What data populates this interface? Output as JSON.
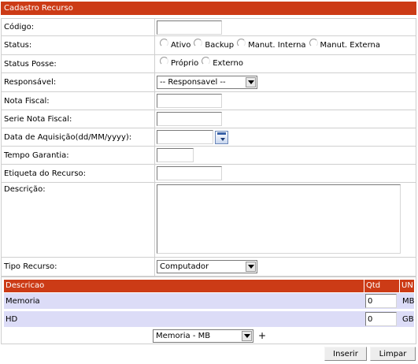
{
  "form": {
    "title": "Cadastro Recurso",
    "codigo": {
      "label": "Código:",
      "value": ""
    },
    "status": {
      "label": "Status:",
      "options": [
        "Ativo",
        "Backup",
        "Manut. Interna",
        "Manut. Externa"
      ]
    },
    "status_posse": {
      "label": "Status Posse:",
      "options": [
        "Próprio",
        "Externo"
      ]
    },
    "responsavel": {
      "label": "Responsável:",
      "selected": "-- Responsavel --"
    },
    "nota_fiscal": {
      "label": "Nota Fiscal:",
      "value": ""
    },
    "serie_nota_fiscal": {
      "label": "Serie Nota Fiscal:",
      "value": ""
    },
    "data_aquisicao": {
      "label": "Data de Aquisição(dd/MM/yyyy):",
      "value": "",
      "icon": "calendar-icon"
    },
    "tempo_garantia": {
      "label": "Tempo Garantia:",
      "value": ""
    },
    "etiqueta": {
      "label": "Etiqueta do Recurso:",
      "value": ""
    },
    "descricao": {
      "label": "Descrição:",
      "value": ""
    },
    "tipo_recurso": {
      "label": "Tipo Recurso:",
      "selected": "Computador"
    }
  },
  "components": {
    "headers": [
      "Descricao",
      "Qtd",
      "UN"
    ],
    "rows": [
      {
        "descricao": "Memoria",
        "qtd": "0",
        "un": "MB"
      },
      {
        "descricao": "HD",
        "qtd": "0",
        "un": "GB"
      }
    ],
    "add_select": "Memoria - MB",
    "add_label": "+"
  },
  "actions": {
    "insert": "Inserir",
    "clear": "Limpar"
  },
  "colors": {
    "header": "#cc3b16",
    "row_bg": "#dcdcf7",
    "border": "#cfcfcf"
  }
}
